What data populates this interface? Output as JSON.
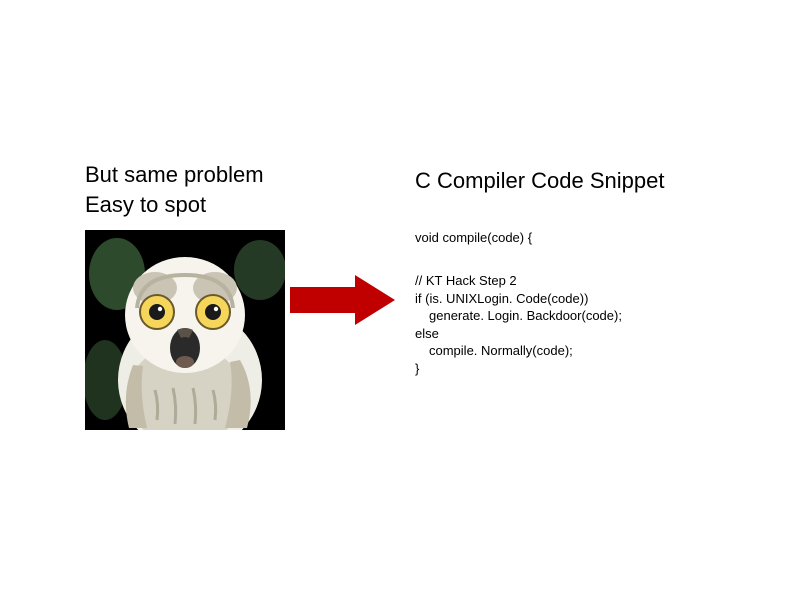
{
  "left": {
    "line1": "But same problem",
    "line2": "Easy to spot"
  },
  "right": {
    "title": "C Compiler Code Snippet"
  },
  "code": {
    "line1": "void compile(code) {",
    "comment": "// KT Hack Step 2",
    "ifline": "if (is. UNIXLogin. Code(code))",
    "thenline": "generate. Login. Backdoor(code);",
    "elseline": "else",
    "else_body": "compile. Normally(code);",
    "close": "}"
  },
  "colors": {
    "arrow": "#c00000"
  },
  "image": {
    "name": "surprised-owl-photo"
  }
}
